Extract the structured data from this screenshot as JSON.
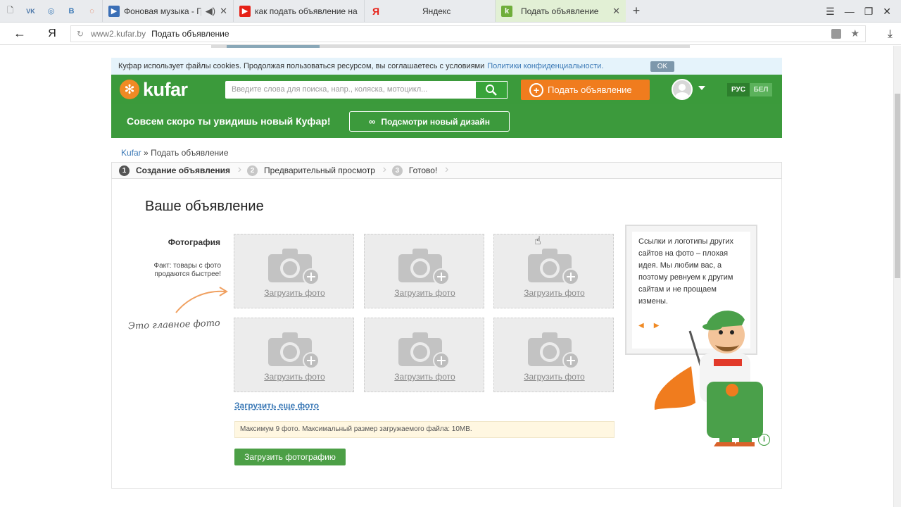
{
  "browser": {
    "tabs": [
      {
        "title": "Фоновая музыка - Гр",
        "color": "#3b6fb6",
        "glyph": "▶"
      },
      {
        "title": "как подать объявление на",
        "color": "#e62117",
        "glyph": "▶"
      },
      {
        "title": "Яндекс",
        "color": "#ffffff",
        "glyph": "Я"
      },
      {
        "title": "Подать объявление",
        "color": "#6fae3a",
        "glyph": "k"
      }
    ],
    "pinned": [
      "VK",
      "◎",
      "B",
      "◌"
    ],
    "host": "www2.kufar.by",
    "page_title": "Подать объявление"
  },
  "cookie": {
    "text": "Куфар использует файлы cookies. Продолжая пользоваться ресурсом, вы соглашаетесь с условиями",
    "link": "Политики конфиденциальности.",
    "ok": "OK"
  },
  "header": {
    "logo": "kufar",
    "search_placeholder": "Введите слова для поиска, напр., коляска, мотоцикл...",
    "post_button": "Подать объявление",
    "lang_ru": "РУС",
    "lang_be": "БЕЛ"
  },
  "banner": {
    "text": "Совсем скоро ты увидишь новый Куфар!",
    "button": "Подсмотри новый дизайн"
  },
  "breadcrumbs": {
    "home": "Kufar",
    "sep": "»",
    "current": "Подать объявление"
  },
  "steps": [
    {
      "num": "1",
      "label": "Создание объявления"
    },
    {
      "num": "2",
      "label": "Предварительный просмотр"
    },
    {
      "num": "3",
      "label": "Готово!"
    }
  ],
  "form": {
    "title": "Ваше объявление",
    "photo_label": "Фотография",
    "fact": "Факт: товары с фото продаются быстрее!",
    "main_photo": "Это главное фото",
    "upload_slot": "Загрузить фото",
    "more": "Загрузить еще фото",
    "note": "Максимум 9 фото. Максимальный размер загружаемого файла: 10MB.",
    "upload_button": "Загрузить фотографию"
  },
  "tip": {
    "text": "Ссылки и логотипы других сайтов на фото – плохая идея. Мы любим вас, а поэтому ревнуем к другим сайтам и не прощаем измены."
  }
}
